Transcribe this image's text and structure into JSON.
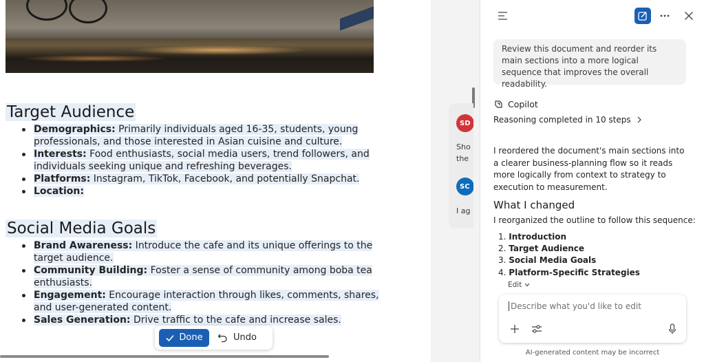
{
  "document": {
    "sections": [
      {
        "heading": "Target Audience",
        "items": [
          {
            "label": "Demographics:",
            "text": " Primarily individuals aged 16-35, students, young professionals, and those interested in Asian cuisine and culture."
          },
          {
            "label": "Interests:",
            "text": " Food enthusiasts, social media users, trend followers, and individuals seeking unique and refreshing beverages."
          },
          {
            "label": "Platforms:",
            "text": " Instagram, TikTok, Facebook, and potentially Snapchat."
          },
          {
            "label": "Location:",
            "text": ""
          }
        ]
      },
      {
        "heading": "Social Media Goals",
        "items": [
          {
            "label": "Brand Awareness:",
            "text": " Introduce the cafe and its unique offerings to the target audience."
          },
          {
            "label": "Community Building:",
            "text": " Foster a sense of community among boba tea enthusiasts."
          },
          {
            "label": "Engagement:",
            "text": " Encourage interaction through likes, comments, shares, and user-generated content."
          },
          {
            "label": "Sales Generation:",
            "text": " Drive traffic to the cafe and increase sales."
          }
        ]
      }
    ]
  },
  "toolbar": {
    "done_label": "Done",
    "undo_label": "Undo"
  },
  "chat_peek": {
    "avatar1": "SD",
    "avatar1_color": "#d13438",
    "text1a": "Sho",
    "text1b": "the",
    "avatar2": "SC",
    "avatar2_color": "#0f6cbd",
    "text2": "I ag"
  },
  "copilot": {
    "user_prompt": "Review this document and reorder its main sections into a more logical sequence that improves the overall readability.",
    "assistant_name": "Copilot",
    "reasoning": "Reasoning completed in 10 steps",
    "response_paragraph": "I reordered the document's main sections into a clearer business-planning flow so it reads more logically from context to strategy to execution to measurement.",
    "heading": "What I changed",
    "intro": "I reorganized the outline to follow this sequence:",
    "steps": [
      {
        "num": "1.",
        "title": "Introduction"
      },
      {
        "num": "2.",
        "title": "Target Audience"
      },
      {
        "num": "3.",
        "title": "Social Media Goals"
      },
      {
        "num": "4.",
        "title": "Platform-Specific Strategies"
      }
    ],
    "edit_label": "Edit",
    "composer_placeholder": "Describe what you'd like to edit",
    "disclaimer": "AI-generated content may be incorrect",
    "accent": "#1a5fb4"
  }
}
